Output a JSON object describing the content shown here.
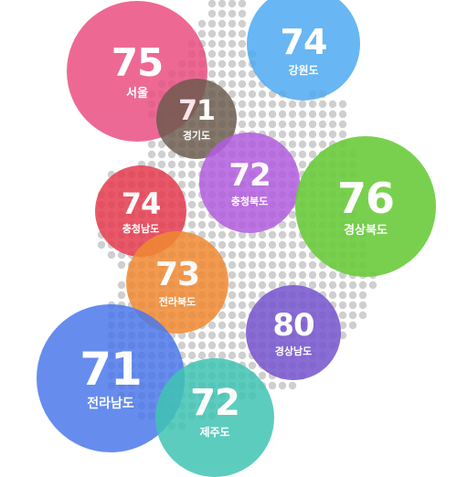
{
  "map": {
    "dot_color": "#cfcfcf"
  },
  "regions": [
    {
      "id": "seoul",
      "value": "75",
      "name": "서울",
      "color": "#ea4f82",
      "opacity": 0.85
    },
    {
      "id": "gangwon",
      "value": "74",
      "name": "강원도",
      "color": "#4eaaf1",
      "opacity": 0.85
    },
    {
      "id": "gyeonggi",
      "value": "71",
      "name": "경기도",
      "color": "#6b5a4c",
      "opacity": 0.82
    },
    {
      "id": "chungbuk",
      "value": "72",
      "name": "충청북도",
      "color": "#b35ee0",
      "opacity": 0.85
    },
    {
      "id": "gyeongbuk",
      "value": "76",
      "name": "경상북도",
      "color": "#6bcc3c",
      "opacity": 0.9
    },
    {
      "id": "chungnam",
      "value": "74",
      "name": "충청남도",
      "color": "#e63c50",
      "opacity": 0.85
    },
    {
      "id": "jeonbuk",
      "value": "73",
      "name": "전라북도",
      "color": "#f08a32",
      "opacity": 0.85
    },
    {
      "id": "gyeongnam",
      "value": "80",
      "name": "경상남도",
      "color": "#7a58d0",
      "opacity": 0.88
    },
    {
      "id": "jeonnam",
      "value": "71",
      "name": "전라남도",
      "color": "#4c78ea",
      "opacity": 0.85
    },
    {
      "id": "jeju",
      "value": "72",
      "name": "제주도",
      "color": "#40c4b4",
      "opacity": 0.85
    }
  ]
}
